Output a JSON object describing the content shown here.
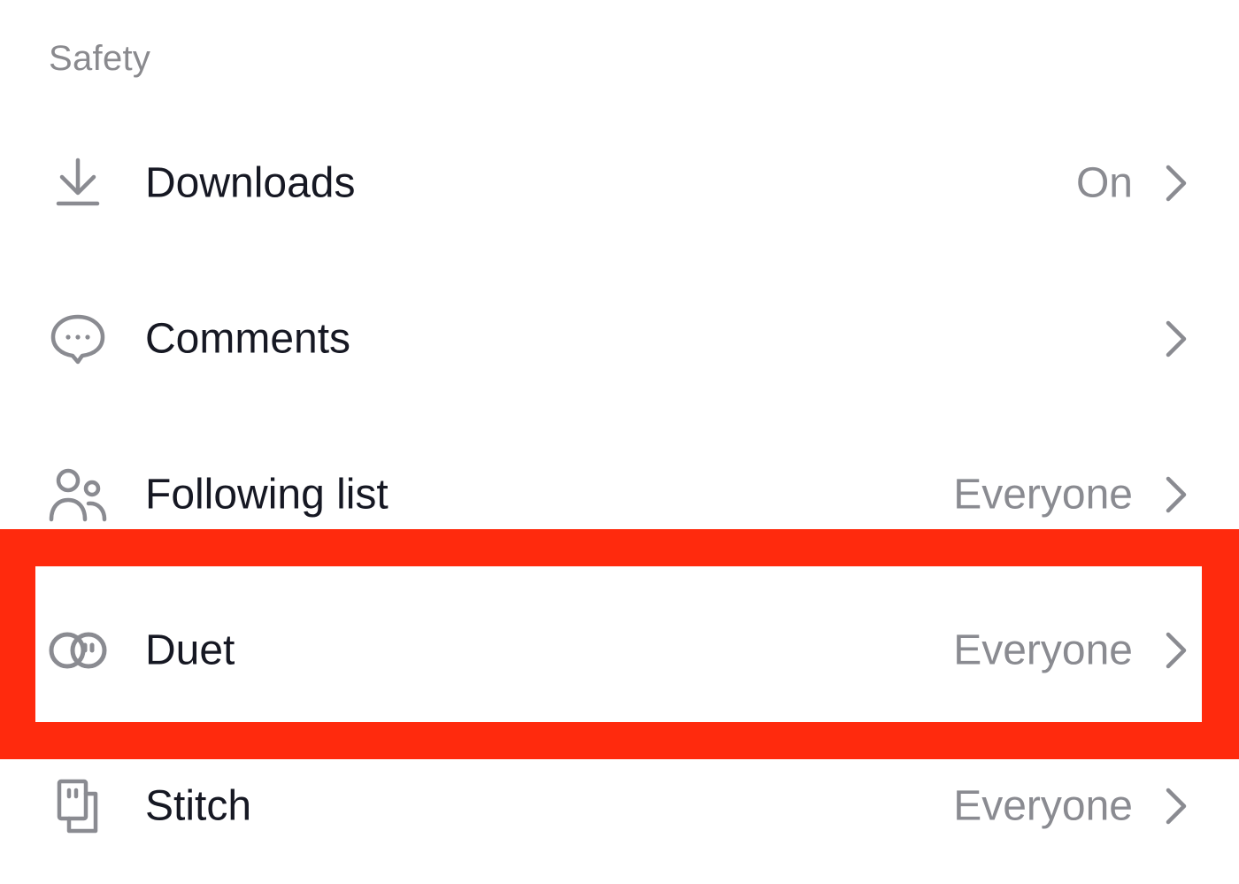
{
  "section": {
    "title": "Safety"
  },
  "rows": [
    {
      "icon": "download-icon",
      "label": "Downloads",
      "value": "On"
    },
    {
      "icon": "comment-bubble-icon",
      "label": "Comments",
      "value": ""
    },
    {
      "icon": "people-icon",
      "label": "Following list",
      "value": "Everyone"
    },
    {
      "icon": "duet-icon",
      "label": "Duet",
      "value": "Everyone",
      "highlighted": true
    },
    {
      "icon": "stitch-icon",
      "label": "Stitch",
      "value": "Everyone"
    }
  ],
  "colors": {
    "label": "#161823",
    "value": "#8a8b91",
    "header": "#8a8a8e",
    "icon": "#8a8b91",
    "highlight": "#ff2a0d",
    "background": "#ffffff"
  }
}
